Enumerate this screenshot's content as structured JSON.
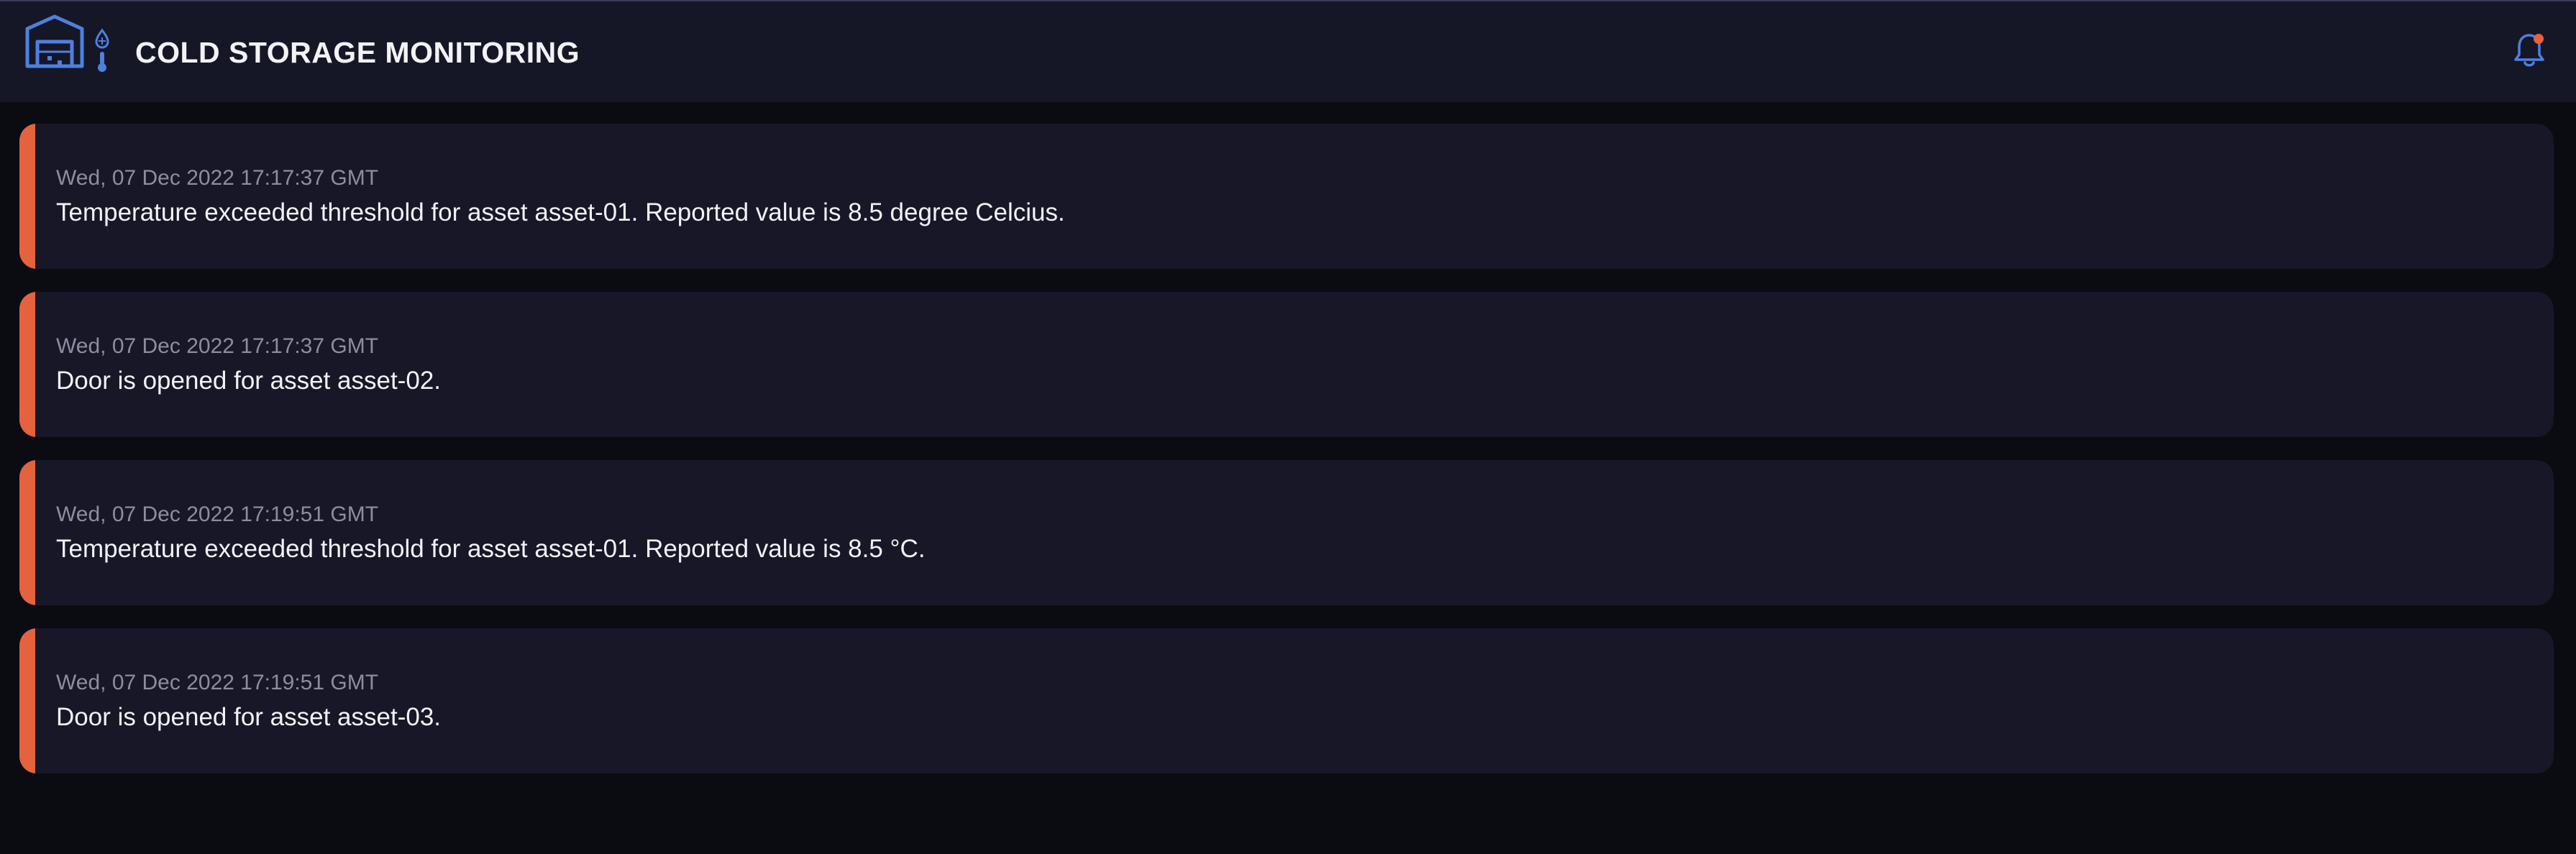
{
  "header": {
    "title": "COLD STORAGE MONITORING",
    "logo_icon": "cold-storage-warehouse-icon",
    "notification_icon": "bell-icon",
    "notification_dot_color": "#e4623e",
    "accent_color": "#4f7fe0"
  },
  "alerts": [
    {
      "timestamp": "Wed, 07 Dec 2022 17:17:37 GMT",
      "message": "Temperature exceeded threshold for asset asset-01. Reported value is 8.5 degree Celcius."
    },
    {
      "timestamp": "Wed, 07 Dec 2022 17:17:37 GMT",
      "message": "Door is opened for asset asset-02."
    },
    {
      "timestamp": "Wed, 07 Dec 2022 17:19:51 GMT",
      "message": "Temperature exceeded threshold for asset asset-01. Reported value is 8.5 °C."
    },
    {
      "timestamp": "Wed, 07 Dec 2022 17:19:51 GMT",
      "message": "Door is opened for asset asset-03."
    }
  ],
  "alert_accent_color": "#e4623e"
}
